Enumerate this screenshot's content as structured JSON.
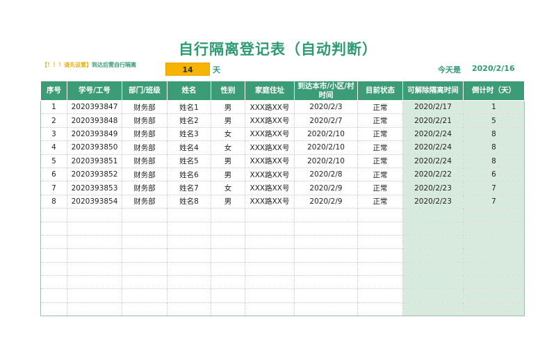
{
  "title": "自行隔离登记表（自动判断）",
  "settings": {
    "warning_prefix": "【！！！请先设置】",
    "warning_text": "到达后需自行隔离",
    "days_value": "14",
    "days_unit": "天",
    "today_label": "今天是",
    "today_value": "2020/2/16"
  },
  "colors": {
    "header_bg": "#3d9c78",
    "title": "#2e9a72",
    "highlight": "#f6b400",
    "tint": "#d8e9dd"
  },
  "table": {
    "headers": [
      "序号",
      "学号/工号",
      "部门/班级",
      "姓名",
      "性别",
      "家庭住址",
      "到达本市/小区/村时间",
      "目前状态",
      "可解除隔离时间",
      "倒计时（天）"
    ],
    "rows": [
      [
        "1",
        "2020393847",
        "财务部",
        "姓名1",
        "男",
        "XXX路XX号",
        "2020/2/3",
        "正常",
        "2020/2/17",
        "1"
      ],
      [
        "2",
        "2020393848",
        "财务部",
        "姓名2",
        "男",
        "XXX路XX号",
        "2020/2/7",
        "正常",
        "2020/2/21",
        "5"
      ],
      [
        "3",
        "2020393849",
        "财务部",
        "姓名3",
        "女",
        "XXX路XX号",
        "2020/2/10",
        "正常",
        "2020/2/24",
        "8"
      ],
      [
        "4",
        "2020393850",
        "财务部",
        "姓名4",
        "女",
        "XXX路XX号",
        "2020/2/10",
        "正常",
        "2020/2/24",
        "8"
      ],
      [
        "5",
        "2020393851",
        "财务部",
        "姓名5",
        "男",
        "XXX路XX号",
        "2020/2/10",
        "正常",
        "2020/2/24",
        "8"
      ],
      [
        "6",
        "2020393852",
        "财务部",
        "姓名6",
        "男",
        "XXX路XX号",
        "2020/2/8",
        "正常",
        "2020/2/22",
        "6"
      ],
      [
        "7",
        "2020393853",
        "财务部",
        "姓名7",
        "女",
        "XXX路XX号",
        "2020/2/9",
        "正常",
        "2020/2/23",
        "7"
      ],
      [
        "8",
        "2020393854",
        "财务部",
        "姓名8",
        "男",
        "XXX路XX号",
        "2020/2/9",
        "正常",
        "2020/2/23",
        "7"
      ]
    ],
    "empty_row_count": 8
  }
}
